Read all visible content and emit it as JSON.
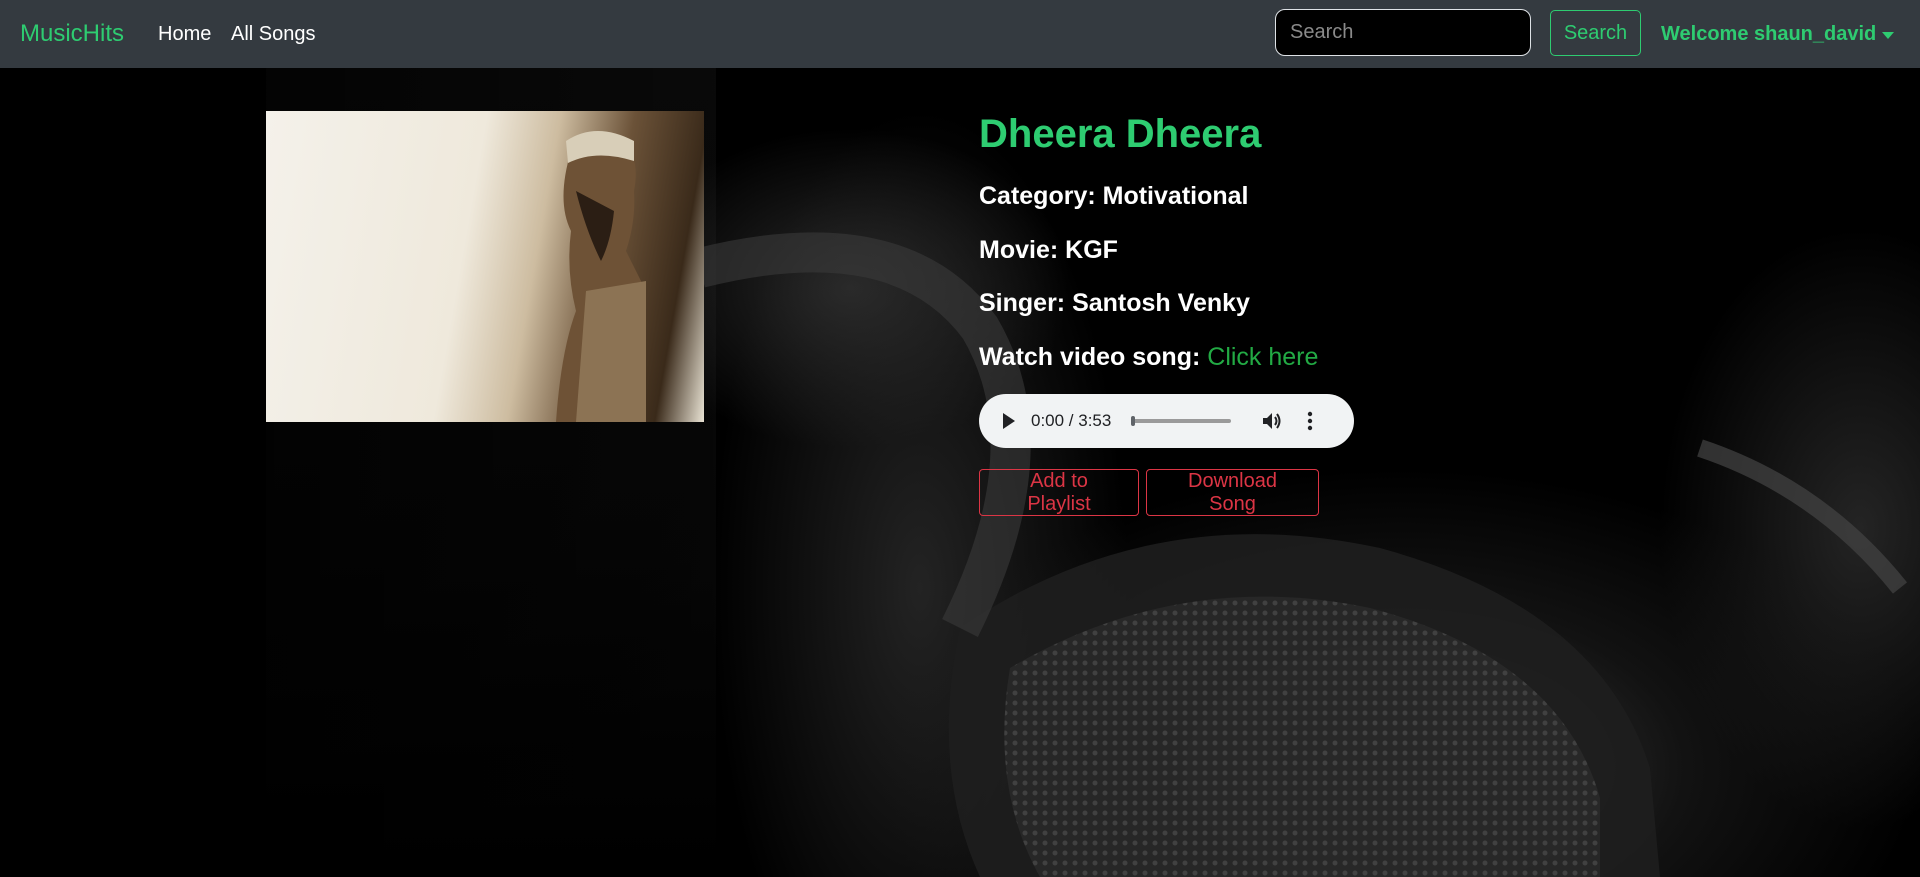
{
  "nav": {
    "brand": "MusicHits",
    "links": [
      "Home",
      "All Songs"
    ],
    "search_placeholder": "Search",
    "search_button": "Search",
    "welcome": "Welcome shaun_david"
  },
  "song": {
    "title": "Dheera Dheera",
    "category_label": "Category:",
    "category": "Motivational",
    "movie_label": "Movie:",
    "movie": "KGF",
    "singer_label": "Singer:",
    "singer": "Santosh Venky",
    "watch_label": "Watch video song:",
    "watch_link": "Click here"
  },
  "player": {
    "time": "0:00 / 3:53",
    "progress": 0
  },
  "actions": {
    "add_playlist": "Add to Playlist",
    "download": "Download Song"
  },
  "colors": {
    "accent": "#2ecc71",
    "danger": "#dc3545",
    "navbar": "#343a40"
  },
  "icons": [
    "play-icon",
    "volume-icon",
    "more-vertical-icon",
    "chevron-down-icon"
  ]
}
